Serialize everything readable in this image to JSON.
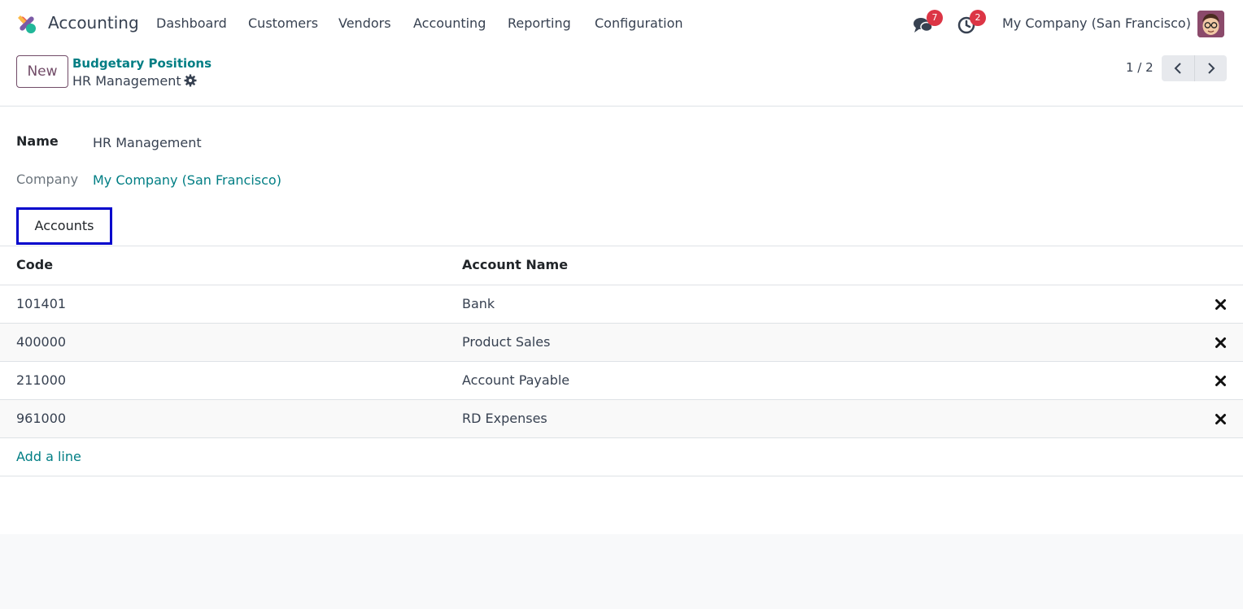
{
  "navbar": {
    "app_name": "Accounting",
    "menu": [
      "Dashboard",
      "Customers",
      "Vendors",
      "Accounting",
      "Reporting",
      "Configuration"
    ],
    "messages_count": "7",
    "activities_count": "2",
    "company": "My Company (San Francisco)",
    "logo_icon": "odoo-app-logo-icon",
    "messages_icon": "chat-bubbles-icon",
    "activities_icon": "clock-icon",
    "avatar_icon": "user-avatar"
  },
  "control_panel": {
    "new_label": "New",
    "breadcrumb_parent": "Budgetary Positions",
    "breadcrumb_current": "HR Management",
    "pager": "1 / 2"
  },
  "form": {
    "name_label": "Name",
    "name_value": "HR Management",
    "company_label": "Company",
    "company_value": "My Company (San Francisco)",
    "tab_label": "Accounts"
  },
  "table": {
    "columns": [
      "Code",
      "Account Name"
    ],
    "rows": [
      {
        "code": "101401",
        "name": "Bank"
      },
      {
        "code": "400000",
        "name": "Product Sales"
      },
      {
        "code": "211000",
        "name": "Account Payable"
      },
      {
        "code": "961000",
        "name": "RD Expenses"
      }
    ],
    "add_line": "Add a line"
  },
  "colors": {
    "accent_teal": "#017e84",
    "brand_purple": "#714b67",
    "badge_red": "#dc3545",
    "tab_highlight": "#0000cc"
  }
}
